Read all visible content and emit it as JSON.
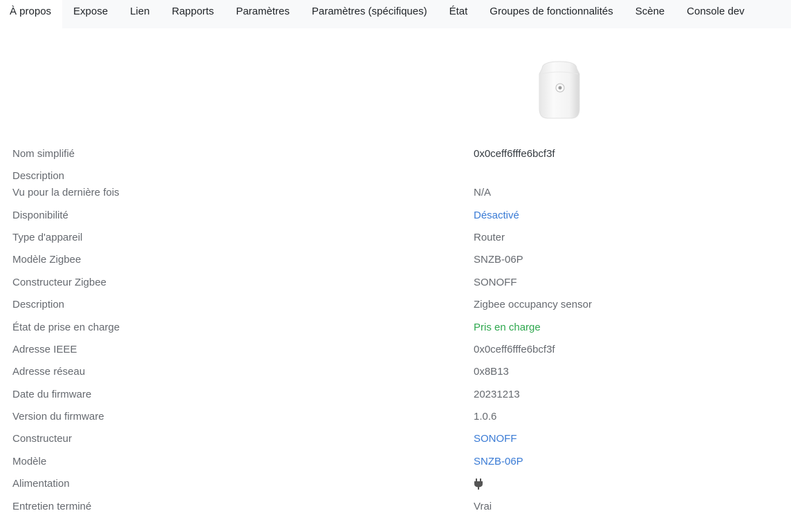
{
  "tabs": [
    {
      "label": "À propos",
      "active": true
    },
    {
      "label": "Expose"
    },
    {
      "label": "Lien"
    },
    {
      "label": "Rapports"
    },
    {
      "label": "Paramètres"
    },
    {
      "label": "Paramètres (spécifiques)"
    },
    {
      "label": "État"
    },
    {
      "label": "Groupes de fonctionnalités"
    },
    {
      "label": "Scène"
    },
    {
      "label": "Console dev"
    }
  ],
  "device": {
    "image_icon": "occupancy-sensor-image",
    "rows": [
      {
        "label": "Nom simplifié",
        "value": "0x0ceff6fffe6bcf3f"
      },
      {
        "label": "Description",
        "value": ""
      },
      {
        "label": "Vu pour la dernière fois",
        "value": "N/A"
      },
      {
        "label": "Disponibilité",
        "value": "Désactivé"
      },
      {
        "label": "Type d'appareil",
        "value": "Router"
      },
      {
        "label": "Modèle Zigbee",
        "value": "SNZB-06P"
      },
      {
        "label": "Constructeur Zigbee",
        "value": "SONOFF"
      },
      {
        "label": "Description",
        "value": "Zigbee occupancy sensor"
      },
      {
        "label": "État de prise en charge",
        "value": "Pris en charge"
      },
      {
        "label": "Adresse IEEE",
        "value": "0x0ceff6fffe6bcf3f"
      },
      {
        "label": "Adresse réseau",
        "value": "0x8B13"
      },
      {
        "label": "Date du firmware",
        "value": "20231213"
      },
      {
        "label": "Version du firmware",
        "value": "1.0.6"
      },
      {
        "label": "Constructeur",
        "value": "SONOFF"
      },
      {
        "label": "Modèle",
        "value": "SNZB-06P"
      },
      {
        "label": "Alimentation",
        "value": "",
        "icon": "plug-icon"
      },
      {
        "label": "Entretien terminé",
        "value": "Vrai"
      }
    ]
  },
  "colors": {
    "link": "#3a7bd5",
    "success": "#2fa84f",
    "muted": "#666a70"
  }
}
